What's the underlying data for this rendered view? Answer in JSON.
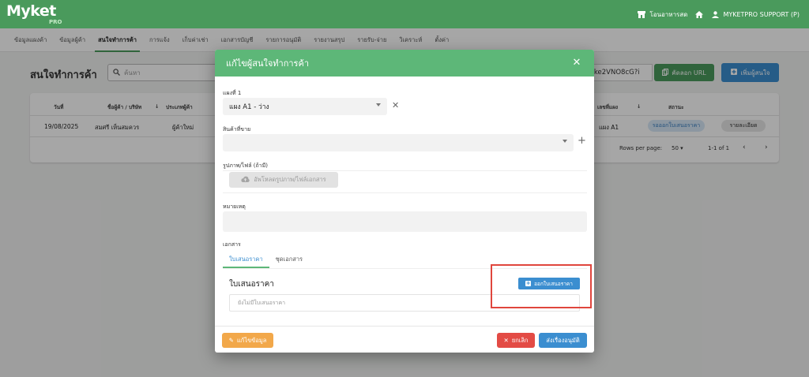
{
  "app": {
    "logo_text": "Myket",
    "logo_sub": "PRO",
    "topbar": {
      "store_label": "โอนอาหารสด",
      "user_label": "MYKETPRO SUPPORT (P)"
    },
    "nav": [
      {
        "label": "ข้อมูลแผงค้า"
      },
      {
        "label": "ข้อมูลผู้ค้า"
      },
      {
        "label": "สนใจทำการค้า",
        "active": true
      },
      {
        "label": "การแจ้ง"
      },
      {
        "label": "เก็บค่าเช่า"
      },
      {
        "label": "เอกสารบัญชี"
      },
      {
        "label": "รายการอนุมัติ"
      },
      {
        "label": "รายงานสรุป"
      },
      {
        "label": "รายรับ-จ่าย"
      },
      {
        "label": "วิเคราะห์"
      },
      {
        "label": "ตั้งค่า"
      }
    ]
  },
  "page": {
    "title": "สนใจทำการค้า",
    "search_placeholder": "ค้นหา",
    "url_text": "i/Qke2VNO8cG?i",
    "copy_url_label": "คัดลอก URL",
    "add_interest_label": "เพิ่มผู้สนใจ"
  },
  "table": {
    "headers": {
      "date": "วันที่",
      "name": "ชื่อผู้ค้า / บริษัท",
      "type": "ประเภทผู้ค้า",
      "stall_no": "เลขที่แผง",
      "status": "สถานะ"
    },
    "row": {
      "date": "19/08/2025",
      "name": "สมศรี เห็นสมควร",
      "type": "ผู้ค้าใหม่",
      "stall": "แผง A1",
      "status": "รอออกใบเสนอราคา",
      "detail": "รายละเอียด"
    },
    "pagination": {
      "rows_per_page_label": "Rows per page:",
      "rows_per_page": "50",
      "range": "1-1 of 1"
    }
  },
  "dialog": {
    "title": "แก้ไขผู้สนใจทำการค้า",
    "stall_label": "แผงที่ 1",
    "stall_value": "แผง A1 - ว่าง",
    "products_label": "สินค้าที่ขาย",
    "files_label": "รูปภาพ/ไฟล์ (ถ้ามี)",
    "upload_label": "อัพโหลดรูปภาพ/ไฟล์เอกสาร",
    "remark_label": "หมายเหตุ",
    "documents_label": "เอกสาร",
    "tabs": [
      {
        "label": "ใบเสนอราคา",
        "active": true
      },
      {
        "label": "ชุดเอกสาร"
      }
    ],
    "quote_title": "ใบเสนอราคา",
    "issue_quote_label": "ออกใบเสนอราคา",
    "empty_quote_text": "ยังไม่มีใบเสนอราคา",
    "footer": {
      "edit_label": "แก้ไขข้อมูล",
      "cancel_label": "ยกเลิก",
      "send_label": "ส่งเรื่องอนุมัติ"
    }
  },
  "colors": {
    "brand_green": "#4a9a5c",
    "dialog_header": "#5db778",
    "primary_blue": "#3b8ed0",
    "danger_red": "#e34b45",
    "warning_orange": "#f2a84a",
    "highlight_red": "#e0463d"
  }
}
